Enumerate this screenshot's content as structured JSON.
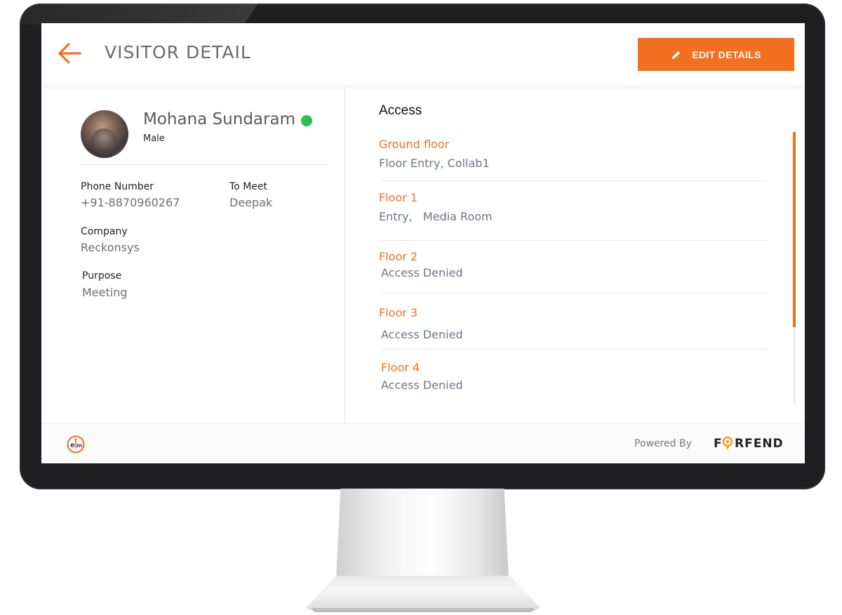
{
  "header": {
    "title": "VISITOR DETAIL",
    "edit_label": "EDIT DETAILS",
    "back_icon": "arrow-left-icon",
    "edit_icon": "pencil-icon"
  },
  "visitor": {
    "name": "Mohana Sundaram",
    "gender": "Male",
    "status_color": "#2dbe54",
    "phone_label": "Phone Number",
    "phone": "+91-8870960267",
    "to_meet_label": "To Meet",
    "to_meet": "Deepak",
    "company_label": "Company",
    "company": "Reckonsys",
    "purpose_label": "Purpose",
    "purpose": "Meeting"
  },
  "access": {
    "title": "Access",
    "floors": [
      {
        "name": "Ground floor",
        "access": "Floor Entry, Collab1"
      },
      {
        "name": "Floor 1",
        "access": "Entry,   Media Room"
      },
      {
        "name": "Floor 2",
        "access": "Access Denied"
      },
      {
        "name": "Floor 3",
        "access": "Access Denied"
      },
      {
        "name": "Floor 4",
        "access": "Access Denied"
      }
    ]
  },
  "footer": {
    "powered_by": "Powered By",
    "brand": "FORFEND",
    "left_logo_icon": "em-logo-icon"
  },
  "colors": {
    "accent": "#f37021",
    "online": "#2dbe54",
    "muted_text": "#6d7686"
  }
}
